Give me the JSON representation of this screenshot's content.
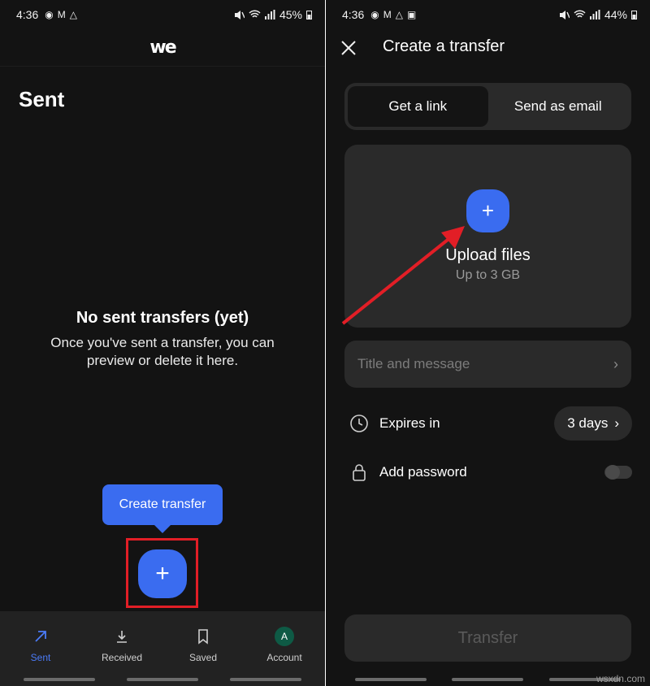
{
  "left": {
    "status": {
      "time": "4:36",
      "battery": "45%"
    },
    "logo": "we",
    "page_title": "Sent",
    "empty_title": "No sent transfers (yet)",
    "empty_desc": "Once you've sent a transfer, you can preview or delete it here.",
    "tooltip": "Create transfer",
    "fab_symbol": "+",
    "nav": [
      {
        "label": "Sent",
        "icon": "arrow-up-right-icon",
        "active": true
      },
      {
        "label": "Received",
        "icon": "download-icon",
        "active": false
      },
      {
        "label": "Saved",
        "icon": "bookmark-icon",
        "active": false
      },
      {
        "label": "Account",
        "icon": "avatar",
        "avatar_letter": "A",
        "active": false
      }
    ]
  },
  "right": {
    "status": {
      "time": "4:36",
      "battery": "44%"
    },
    "title": "Create a transfer",
    "tabs": [
      {
        "label": "Get a link",
        "active": true
      },
      {
        "label": "Send as email",
        "active": false
      }
    ],
    "upload": {
      "symbol": "+",
      "title": "Upload files",
      "subtitle": "Up to 3 GB"
    },
    "title_field_placeholder": "Title and message",
    "expires": {
      "label": "Expires in",
      "value": "3 days"
    },
    "password": {
      "label": "Add password",
      "enabled": false
    },
    "transfer_button": "Transfer"
  },
  "colors": {
    "accent": "#3a6cf0",
    "highlight": "#e21e26",
    "background": "#131313",
    "surface": "#2a2a2a"
  },
  "watermark": "wsxdn.com"
}
